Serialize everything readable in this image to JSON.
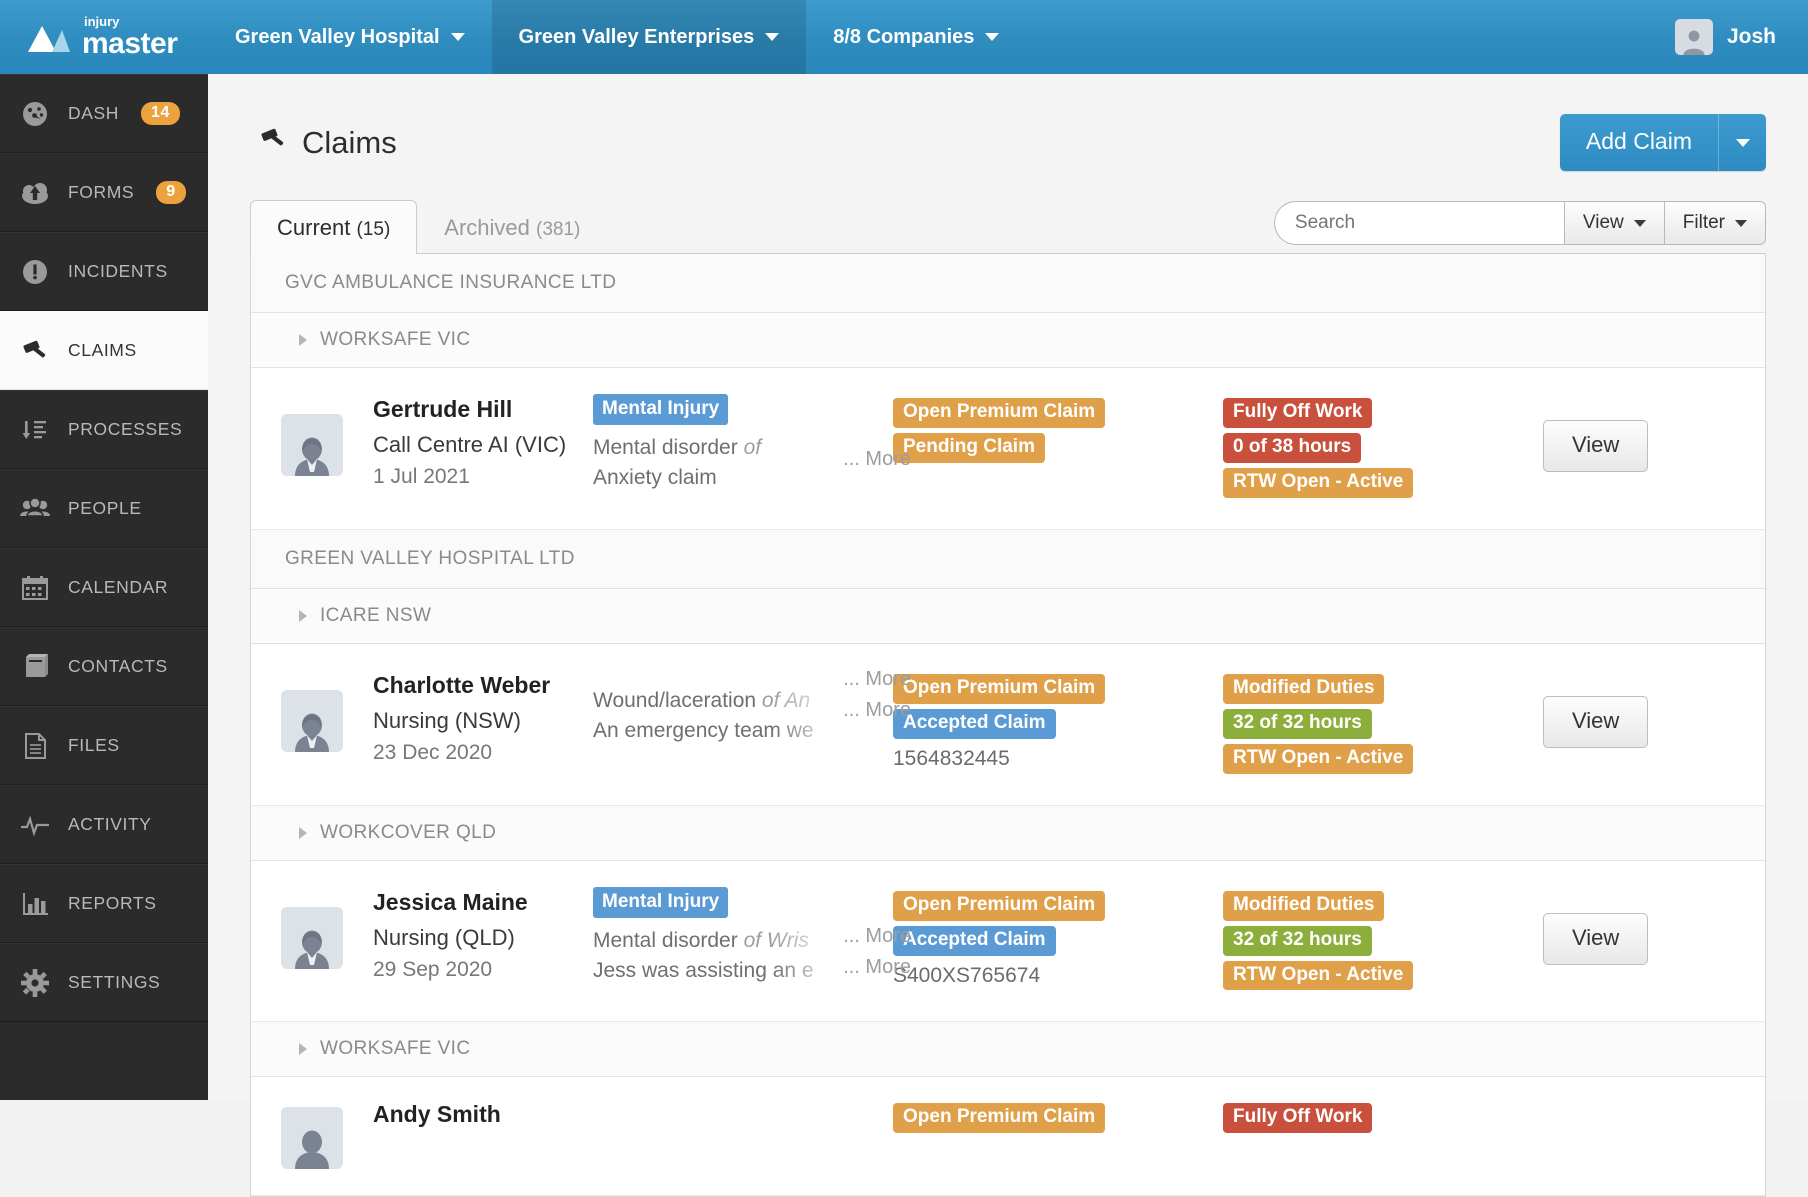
{
  "app": {
    "brand_small": "injury",
    "brand_large": "master",
    "colors": {
      "brand_blue": "#2f8cbf",
      "orange": "#eca33d",
      "blue_tag": "#5b9bd5",
      "red": "#c9503c",
      "green": "#8cae3a",
      "sidebar_dark": "#2b2b2b"
    }
  },
  "topbar": {
    "tabs": [
      {
        "label": "Green Valley Hospital",
        "active": false
      },
      {
        "label": "Green Valley Enterprises",
        "active": true
      },
      {
        "label": "8/8 Companies",
        "active": false
      }
    ],
    "user": {
      "name": "Josh",
      "avatar_icon": "user-avatar-icon"
    }
  },
  "sidebar": {
    "items": [
      {
        "label": "DASH",
        "icon": "gauge-icon",
        "badge": "14",
        "active": false
      },
      {
        "label": "FORMS",
        "icon": "cloud-upload-icon",
        "badge": "9",
        "active": false
      },
      {
        "label": "INCIDENTS",
        "icon": "exclamation-circle-icon",
        "badge": "",
        "active": false
      },
      {
        "label": "CLAIMS",
        "icon": "gavel-icon",
        "badge": "",
        "active": true
      },
      {
        "label": "PROCESSES",
        "icon": "sort-list-icon",
        "badge": "",
        "active": false
      },
      {
        "label": "PEOPLE",
        "icon": "people-icon",
        "badge": "",
        "active": false
      },
      {
        "label": "CALENDAR",
        "icon": "calendar-icon",
        "badge": "",
        "active": false
      },
      {
        "label": "CONTACTS",
        "icon": "address-book-icon",
        "badge": "",
        "active": false
      },
      {
        "label": "FILES",
        "icon": "document-icon",
        "badge": "",
        "active": false
      },
      {
        "label": "ACTIVITY",
        "icon": "pulse-icon",
        "badge": "",
        "active": false
      },
      {
        "label": "REPORTS",
        "icon": "bar-chart-icon",
        "badge": "",
        "active": false
      },
      {
        "label": "SETTINGS",
        "icon": "gear-icon",
        "badge": "",
        "active": false
      }
    ]
  },
  "page": {
    "title": "Claims",
    "title_icon": "gavel-icon",
    "add_button": "Add Claim",
    "add_button_caret_icon": "chevron-down-icon"
  },
  "tabs": [
    {
      "label": "Current",
      "count": "(15)",
      "active": true
    },
    {
      "label": "Archived",
      "count": "(381)",
      "active": false
    }
  ],
  "search": {
    "placeholder": "Search",
    "value": "",
    "view_label": "View",
    "filter_label": "Filter"
  },
  "groups": [
    {
      "company": "GVC AMBULANCE INSURANCE LTD",
      "insurers": [
        {
          "name": "WORKSAFE VIC",
          "claims": [
            {
              "name": "Gertrude Hill",
              "role": "Call Centre AI (VIC)",
              "date": "1 Jul 2021",
              "injury_tag": "Mental Injury",
              "desc_prefix": "Mental disorder",
              "desc_italic": "of",
              "desc_line2": "Anxiety claim",
              "more_label": "... More",
              "more_label_2": "",
              "status_pills": [
                {
                  "text": "Open Premium Claim",
                  "color": "#e0a04a"
                },
                {
                  "text": "Pending Claim",
                  "color": "#e0a04a"
                }
              ],
              "claim_number": "",
              "rtw_pills": [
                {
                  "text": "Fully Off Work",
                  "color": "#c9503c"
                },
                {
                  "text": "0 of 38 hours",
                  "color": "#c9503c"
                },
                {
                  "text": "RTW Open - Active",
                  "color": "#e0a04a"
                }
              ],
              "view_label": "View"
            }
          ]
        }
      ]
    },
    {
      "company": "GREEN VALLEY HOSPITAL LTD",
      "insurers": [
        {
          "name": "ICARE NSW",
          "claims": [
            {
              "name": "Charlotte Weber",
              "role": "Nursing (NSW)",
              "date": "23 Dec 2020",
              "injury_tag": "",
              "desc_prefix": "Wound/laceration",
              "desc_italic": "of An",
              "desc_line2": "An emergency team we",
              "more_label": "... More",
              "more_label_2": "... More",
              "status_pills": [
                {
                  "text": "Open Premium Claim",
                  "color": "#e0a04a"
                },
                {
                  "text": "Accepted Claim",
                  "color": "#5b9bd5"
                }
              ],
              "claim_number": "1564832445",
              "rtw_pills": [
                {
                  "text": "Modified Duties",
                  "color": "#e0a04a"
                },
                {
                  "text": "32 of 32 hours",
                  "color": "#8cae3a"
                },
                {
                  "text": "RTW Open - Active",
                  "color": "#e0a04a"
                }
              ],
              "view_label": "View"
            }
          ]
        },
        {
          "name": "WORKCOVER QLD",
          "claims": [
            {
              "name": "Jessica Maine",
              "role": "Nursing (QLD)",
              "date": "29 Sep 2020",
              "injury_tag": "Mental Injury",
              "desc_prefix": "Mental disorder",
              "desc_italic": "of Wris",
              "desc_line2": "Jess was assisting an e",
              "more_label": "... More",
              "more_label_2": "... More",
              "status_pills": [
                {
                  "text": "Open Premium Claim",
                  "color": "#e0a04a"
                },
                {
                  "text": "Accepted Claim",
                  "color": "#5b9bd5"
                }
              ],
              "claim_number": "S400XS765674",
              "rtw_pills": [
                {
                  "text": "Modified Duties",
                  "color": "#e0a04a"
                },
                {
                  "text": "32 of 32 hours",
                  "color": "#8cae3a"
                },
                {
                  "text": "RTW Open - Active",
                  "color": "#e0a04a"
                }
              ],
              "view_label": "View"
            }
          ]
        },
        {
          "name": "WORKSAFE VIC",
          "claims": [
            {
              "name": "Andy Smith",
              "role": "",
              "date": "",
              "injury_tag": "",
              "desc_prefix": "",
              "desc_italic": "",
              "desc_line2": "",
              "more_label": "",
              "more_label_2": "",
              "status_pills": [
                {
                  "text": "Open Premium Claim",
                  "color": "#e0a04a"
                }
              ],
              "claim_number": "",
              "rtw_pills": [
                {
                  "text": "Fully Off Work",
                  "color": "#c9503c"
                }
              ],
              "view_label": ""
            }
          ]
        }
      ]
    }
  ]
}
